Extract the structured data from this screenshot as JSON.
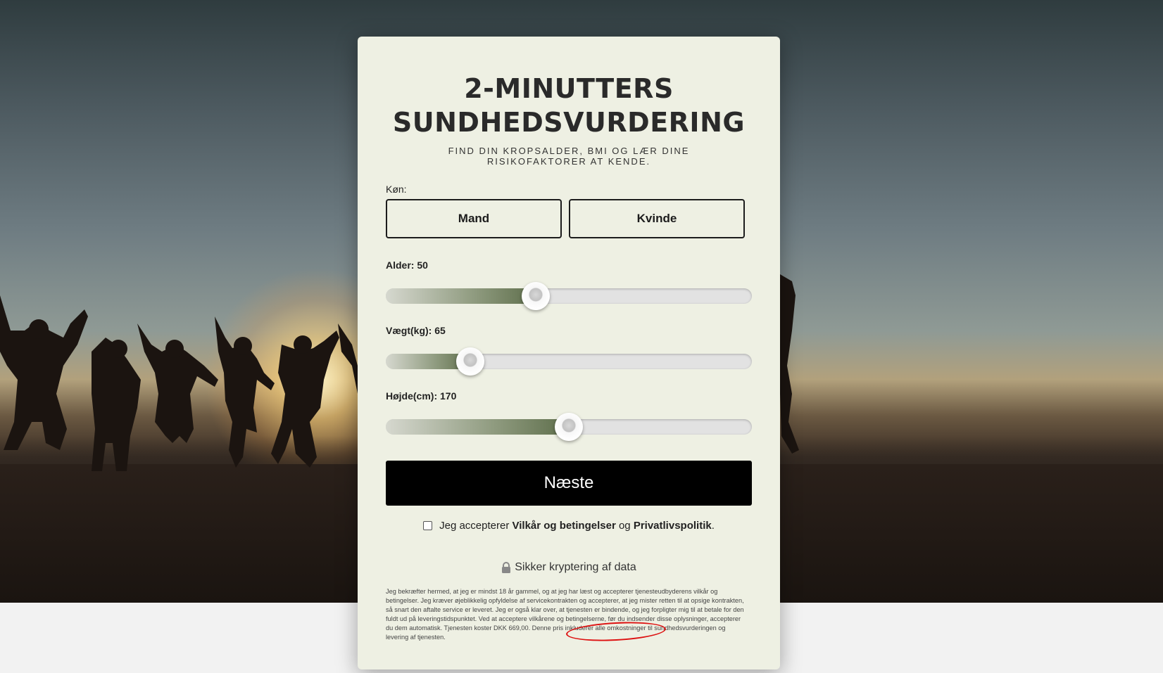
{
  "header": {
    "title_line1": "2-MINUTTERS",
    "title_line2": "SUNDHEDSVURDERING",
    "subtitle": "FIND DIN KROPSALDER, BMI OG LÆR DINE RISIKOFAKTORER AT KENDE."
  },
  "gender": {
    "label": "Køn:",
    "options": [
      "Mand",
      "Kvinde"
    ]
  },
  "sliders": {
    "age": {
      "label": "Alder:",
      "value": "50",
      "fraction": 0.41
    },
    "weight": {
      "label": "Vægt(kg):",
      "value": "65",
      "fraction": 0.23
    },
    "height": {
      "label": "Højde(cm):",
      "value": "170",
      "fraction": 0.5
    }
  },
  "next_label": "Næste",
  "terms": {
    "prefix": "Jeg accepterer",
    "terms_link": "Vilkår og betingelser",
    "conjunction": "og",
    "privacy_link": "Privatlivspolitik",
    "suffix": ".",
    "checked": false
  },
  "secure": {
    "icon": "lock-icon",
    "text": "Sikker kryptering af data"
  },
  "fineprint": "Jeg bekræfter hermed, at jeg er mindst 18 år gammel, og at jeg har læst og accepterer tjenesteudbyderens vilkår og betingelser. Jeg kræver øjeblikkelig opfyldelse af servicekontrakten og accepterer, at jeg mister retten til at opsige kontrakten, så snart den aftalte service er leveret. Jeg er også klar over, at tjenesten er bindende, og jeg forpligter mig til at betale for den fuldt ud på leveringstidspunktet. Ved at acceptere vilkårene og betingelserne, før du indsender disse oplysninger, accepterer du dem automatisk. Tjenesten koster DKK 669,00. Denne pris inkluderer alle omkostninger til sundhedsvurderingen og levering af tjenesten.",
  "colors": {
    "card_bg": "#eef0e3",
    "slider_fill": "#5e6e4b",
    "button_bg": "#000000",
    "highlight_circle": "#dd1111"
  }
}
